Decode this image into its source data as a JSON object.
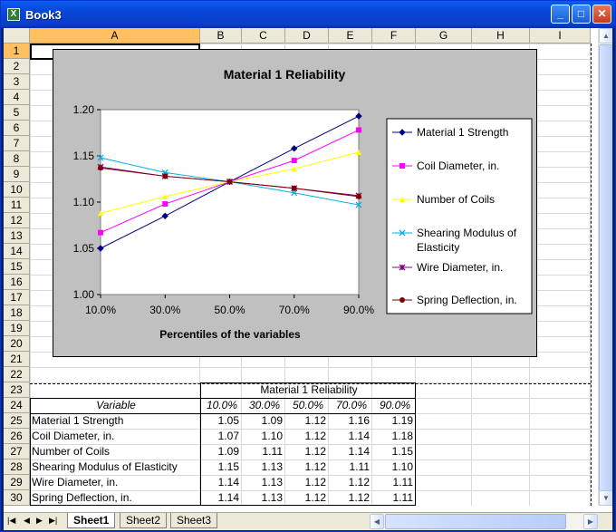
{
  "window": {
    "title": "Book3",
    "app_icon": "X",
    "minimize": "_",
    "maximize": "□",
    "close": "✕"
  },
  "columns": [
    "A",
    "B",
    "C",
    "D",
    "E",
    "F",
    "G",
    "H",
    "I"
  ],
  "rows": [
    "1",
    "2",
    "3",
    "4",
    "5",
    "6",
    "7",
    "8",
    "9",
    "10",
    "11",
    "12",
    "13",
    "14",
    "15",
    "16",
    "17",
    "18",
    "19",
    "20",
    "21",
    "22",
    "23",
    "24",
    "25",
    "26",
    "27",
    "28",
    "29",
    "30"
  ],
  "chart_data": {
    "type": "line",
    "title": "Material 1 Reliability",
    "xlabel": "Percentiles of the variables",
    "ylabel": "",
    "categories": [
      "10.0%",
      "30.0%",
      "50.0%",
      "70.0%",
      "90.0%"
    ],
    "ylim": [
      1.0,
      1.2
    ],
    "yticks": [
      "1.00",
      "1.05",
      "1.10",
      "1.15",
      "1.20"
    ],
    "legend_position": "right",
    "series": [
      {
        "name": "Material 1 Strength",
        "values": [
          1.05,
          1.085,
          1.122,
          1.158,
          1.193
        ],
        "color": "#000080",
        "marker": "diamond"
      },
      {
        "name": "Coil Diameter, in.",
        "values": [
          1.067,
          1.098,
          1.122,
          1.145,
          1.178
        ],
        "color": "#ff00ff",
        "marker": "square"
      },
      {
        "name": "Number of Coils",
        "values": [
          1.088,
          1.106,
          1.122,
          1.136,
          1.154
        ],
        "color": "#ffff00",
        "marker": "triangle"
      },
      {
        "name": "Shearing Modulus of Elasticity",
        "values": [
          1.148,
          1.132,
          1.122,
          1.11,
          1.097
        ],
        "color": "#00b0e0",
        "marker": "x"
      },
      {
        "name": "Wire Diameter, in.",
        "values": [
          1.138,
          1.128,
          1.122,
          1.115,
          1.107
        ],
        "color": "#800080",
        "marker": "star"
      },
      {
        "name": "Spring Deflection, in.",
        "values": [
          1.137,
          1.128,
          1.122,
          1.115,
          1.106
        ],
        "color": "#800000",
        "marker": "circle"
      }
    ]
  },
  "legend_lines": [
    [
      "Material 1 Strength"
    ],
    [
      "Coil Diameter, in."
    ],
    [
      "Number of Coils"
    ],
    [
      "Shearing Modulus of",
      "Elasticity"
    ],
    [
      "Wire Diameter, in."
    ],
    [
      "Spring Deflection, in."
    ]
  ],
  "table": {
    "title": "Material 1 Reliability",
    "header_variable": "Variable",
    "header_pcts": [
      "10.0%",
      "30.0%",
      "50.0%",
      "70.0%",
      "90.0%"
    ],
    "rows": [
      {
        "name": "Material 1 Strength",
        "vals": [
          "1.05",
          "1.09",
          "1.12",
          "1.16",
          "1.19"
        ]
      },
      {
        "name": "Coil Diameter, in.",
        "vals": [
          "1.07",
          "1.10",
          "1.12",
          "1.14",
          "1.18"
        ]
      },
      {
        "name": "Number of Coils",
        "vals": [
          "1.09",
          "1.11",
          "1.12",
          "1.14",
          "1.15"
        ]
      },
      {
        "name": "Shearing Modulus of Elasticity",
        "vals": [
          "1.15",
          "1.13",
          "1.12",
          "1.11",
          "1.10"
        ]
      },
      {
        "name": "Wire Diameter, in.",
        "vals": [
          "1.14",
          "1.13",
          "1.12",
          "1.12",
          "1.11"
        ]
      },
      {
        "name": "Spring Deflection, in.",
        "vals": [
          "1.14",
          "1.13",
          "1.12",
          "1.12",
          "1.11"
        ]
      }
    ]
  },
  "sheets": [
    "Sheet1",
    "Sheet2",
    "Sheet3"
  ],
  "active_sheet": "Sheet1"
}
